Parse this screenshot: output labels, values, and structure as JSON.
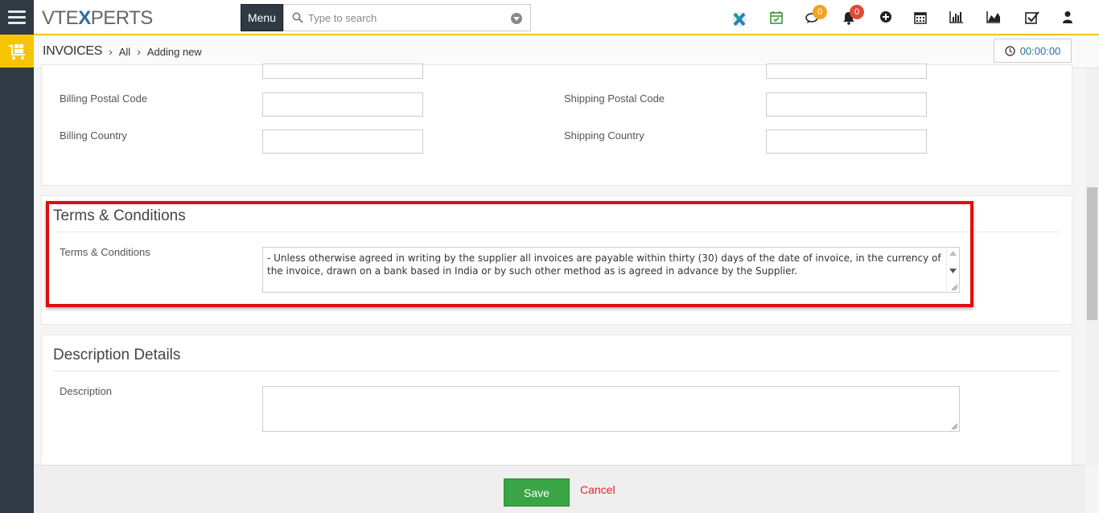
{
  "app": {
    "logo_left": "VTE",
    "logo_x": "X",
    "logo_right": "PERTS",
    "menu_label": "Menu",
    "search_placeholder": "Type to search"
  },
  "topbar_icons": [
    {
      "name": "vtexperts-x-icon"
    },
    {
      "name": "calendar-check-icon"
    },
    {
      "name": "comments-icon",
      "badge": "0",
      "badge_color": "#f5a21d"
    },
    {
      "name": "bell-icon",
      "badge": "0",
      "badge_color": "#e04a35"
    },
    {
      "name": "plus-circle-icon"
    },
    {
      "name": "calendar-icon"
    },
    {
      "name": "bar-chart-icon"
    },
    {
      "name": "area-chart-icon"
    },
    {
      "name": "check-square-icon"
    },
    {
      "name": "user-icon"
    }
  ],
  "breadcrumb": {
    "module": "INVOICES",
    "level1": "All",
    "level2": "Adding new"
  },
  "timer": "00:00:00",
  "address": {
    "billing_postal_label": "Billing Postal Code",
    "billing_postal_value": "",
    "billing_country_label": "Billing Country",
    "billing_country_value": "",
    "shipping_postal_label": "Shipping Postal Code",
    "shipping_postal_value": "",
    "shipping_country_label": "Shipping Country",
    "shipping_country_value": ""
  },
  "terms": {
    "section_title": "Terms & Conditions",
    "field_label": "Terms & Conditions",
    "value": " - Unless otherwise agreed in writing by the supplier all invoices are payable within thirty (30) days of the date of invoice, in the currency of the invoice, drawn on a bank based in India or by such other method as is agreed in advance by the Supplier."
  },
  "description": {
    "section_title": "Description Details",
    "field_label": "Description",
    "value": ""
  },
  "footer": {
    "save_label": "Save",
    "cancel_label": "Cancel"
  },
  "colors": {
    "accent_yellow": "#f3c400",
    "highlight_red": "#e10d0d",
    "save_green": "#3aa545",
    "cancel_red": "#e1261c",
    "link_blue": "#2a6f9a"
  }
}
